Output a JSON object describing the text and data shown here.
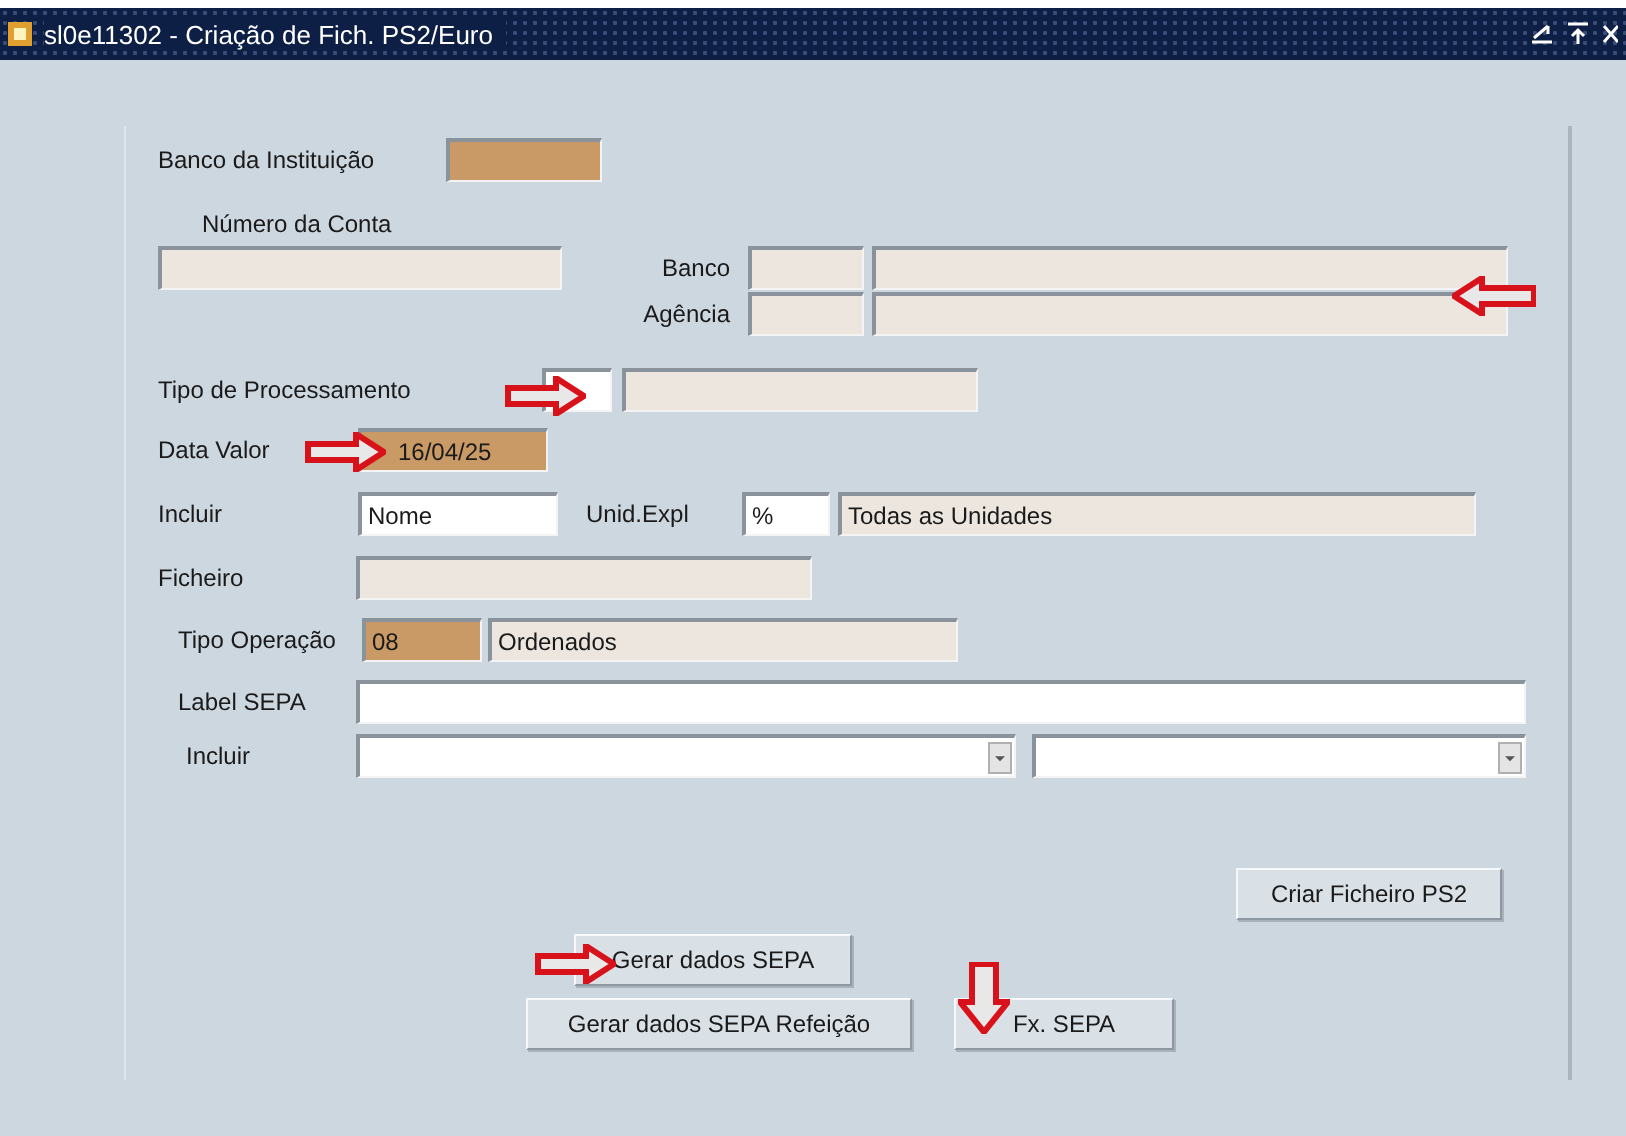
{
  "window": {
    "title": "sl0e11302 - Criação de Fich. PS2/Euro"
  },
  "banco_instituicao": {
    "label": "Banco da Instituição"
  },
  "numero_conta": {
    "label": "Número da Conta"
  },
  "banco": {
    "label": "Banco"
  },
  "agencia": {
    "label": "Agência"
  },
  "tipo_processamento": {
    "label": "Tipo de Processamento"
  },
  "data_valor": {
    "label": "Data Valor",
    "value": "16/04/25"
  },
  "incluir": {
    "label": "Incluir",
    "value": "Nome"
  },
  "unid_expl": {
    "label": "Unid.Expl",
    "code": "%",
    "value": "Todas as Unidades"
  },
  "ficheiro": {
    "label": "Ficheiro"
  },
  "tipo_operacao": {
    "label": "Tipo Operação",
    "code": "08",
    "value": "Ordenados"
  },
  "label_sepa": {
    "label": "Label SEPA"
  },
  "incluir_sepa": {
    "label": "Incluir"
  },
  "buttons": [
    {
      "label": "Criar Ficheiro PS2"
    },
    {
      "label": "Gerar dados SEPA"
    },
    {
      "label": "Gerar dados SEPA Refeição"
    },
    {
      "label": "Fx. SEPA"
    }
  ]
}
